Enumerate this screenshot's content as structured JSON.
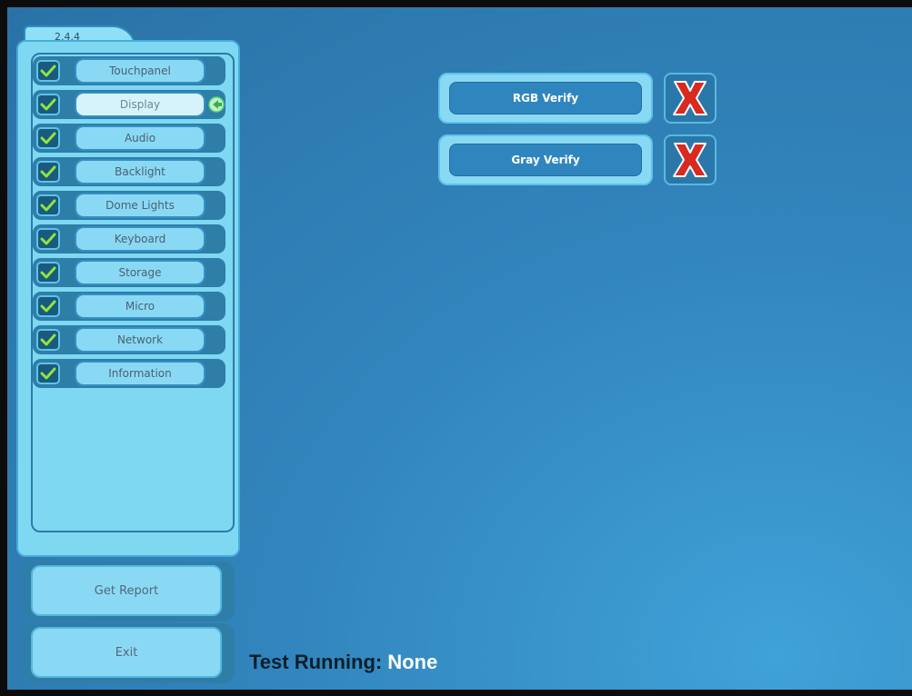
{
  "app": {
    "version": "2.4.4"
  },
  "tests": [
    {
      "label": "Touchpanel",
      "passed": true,
      "active": false
    },
    {
      "label": "Display",
      "passed": true,
      "active": true
    },
    {
      "label": "Audio",
      "passed": true,
      "active": false
    },
    {
      "label": "Backlight",
      "passed": true,
      "active": false
    },
    {
      "label": "Dome Lights",
      "passed": true,
      "active": false
    },
    {
      "label": "Keyboard",
      "passed": true,
      "active": false
    },
    {
      "label": "Storage",
      "passed": true,
      "active": false
    },
    {
      "label": "Micro",
      "passed": true,
      "active": false
    },
    {
      "label": "Network",
      "passed": true,
      "active": false
    },
    {
      "label": "Information",
      "passed": true,
      "active": false
    }
  ],
  "actions": {
    "get_report": "Get Report",
    "exit": "Exit"
  },
  "verify": {
    "rgb_label": "RGB Verify",
    "rgb_status": "fail",
    "gray_label": "Gray Verify",
    "gray_status": "fail"
  },
  "status": {
    "running_label": "Test Running:",
    "running_value": "None"
  },
  "colors": {
    "pass_check": "#8ee63c",
    "fail_x": "#d82a1e",
    "background": "#3285bd"
  }
}
